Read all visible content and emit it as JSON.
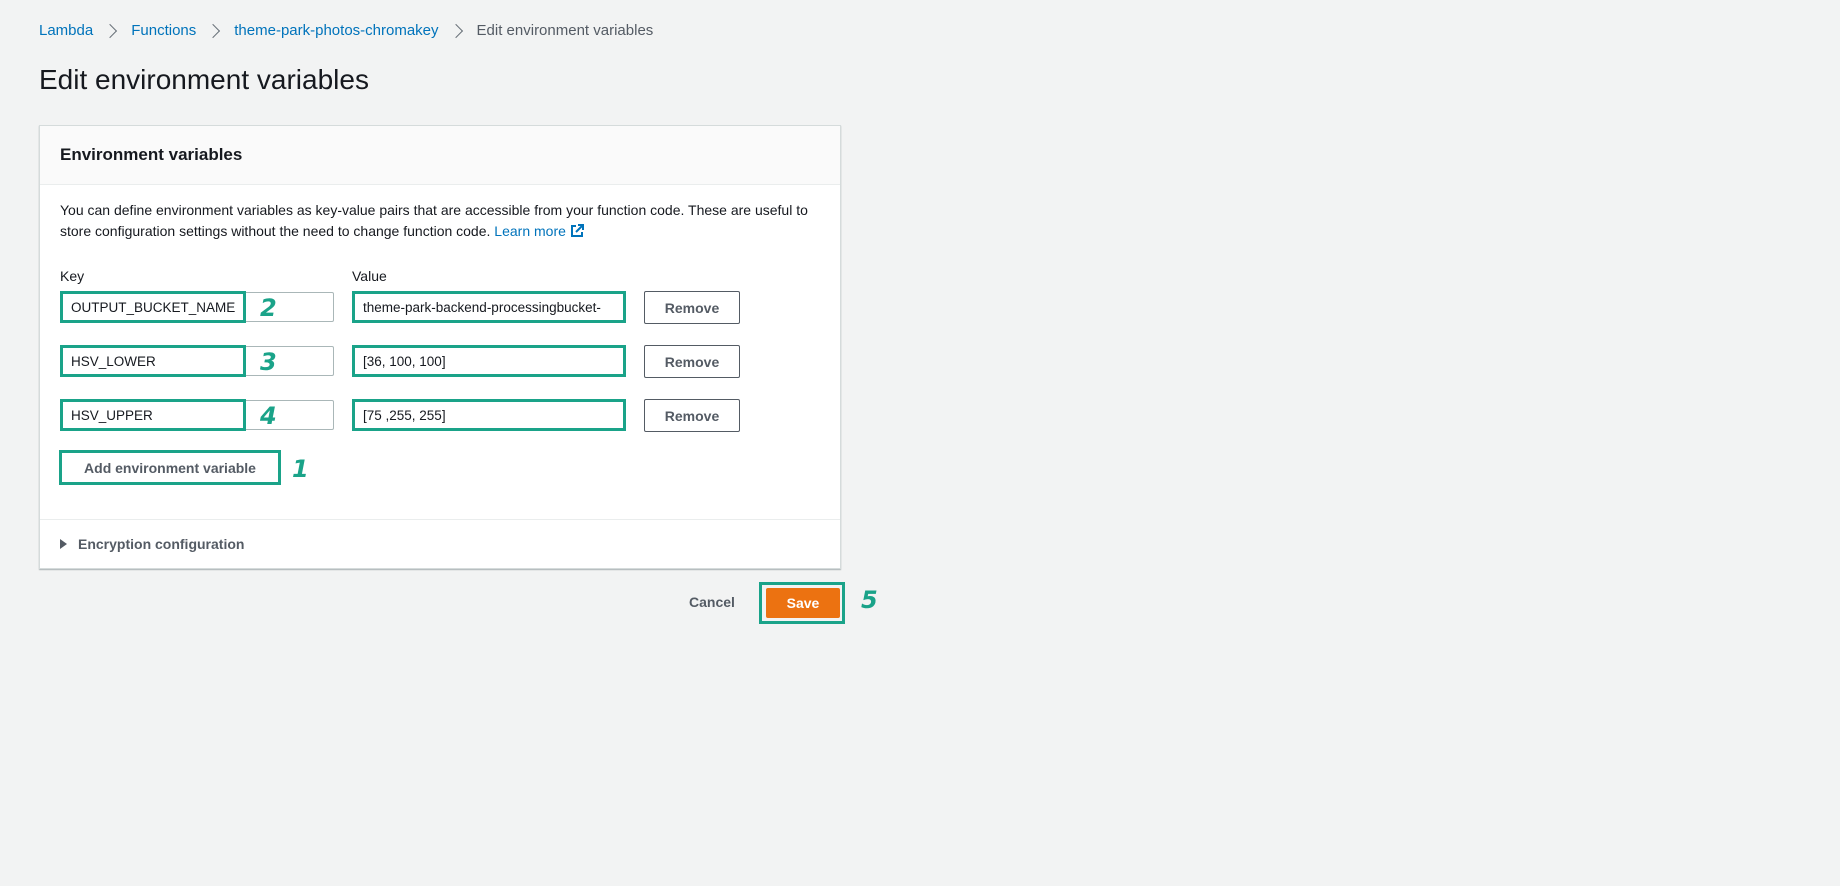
{
  "breadcrumb": {
    "items": [
      "Lambda",
      "Functions",
      "theme-park-photos-chromakey"
    ],
    "current": "Edit environment variables"
  },
  "page": {
    "title": "Edit environment variables"
  },
  "panel": {
    "title": "Environment variables",
    "description": "You can define environment variables as key-value pairs that are accessible from your function code. These are useful to store configuration settings without the need to change function code.",
    "learn_more": "Learn more",
    "key_label": "Key",
    "value_label": "Value",
    "variables": [
      {
        "key": "OUTPUT_BUCKET_NAME",
        "value": "theme-park-backend-processingbucket-",
        "remove_label": "Remove",
        "badge": "2"
      },
      {
        "key": "HSV_LOWER",
        "value": "[36, 100, 100]",
        "remove_label": "Remove",
        "badge": "3"
      },
      {
        "key": "HSV_UPPER",
        "value": "[75 ,255, 255]",
        "remove_label": "Remove",
        "badge": "4"
      }
    ],
    "add_label": "Add environment variable",
    "add_badge": "1",
    "encryption_label": "Encryption configuration"
  },
  "footer": {
    "cancel_label": "Cancel",
    "save_label": "Save",
    "save_badge": "5"
  },
  "colors": {
    "accent_highlight": "#1aa389",
    "save_button": "#ec7211",
    "link": "#0073bb"
  }
}
